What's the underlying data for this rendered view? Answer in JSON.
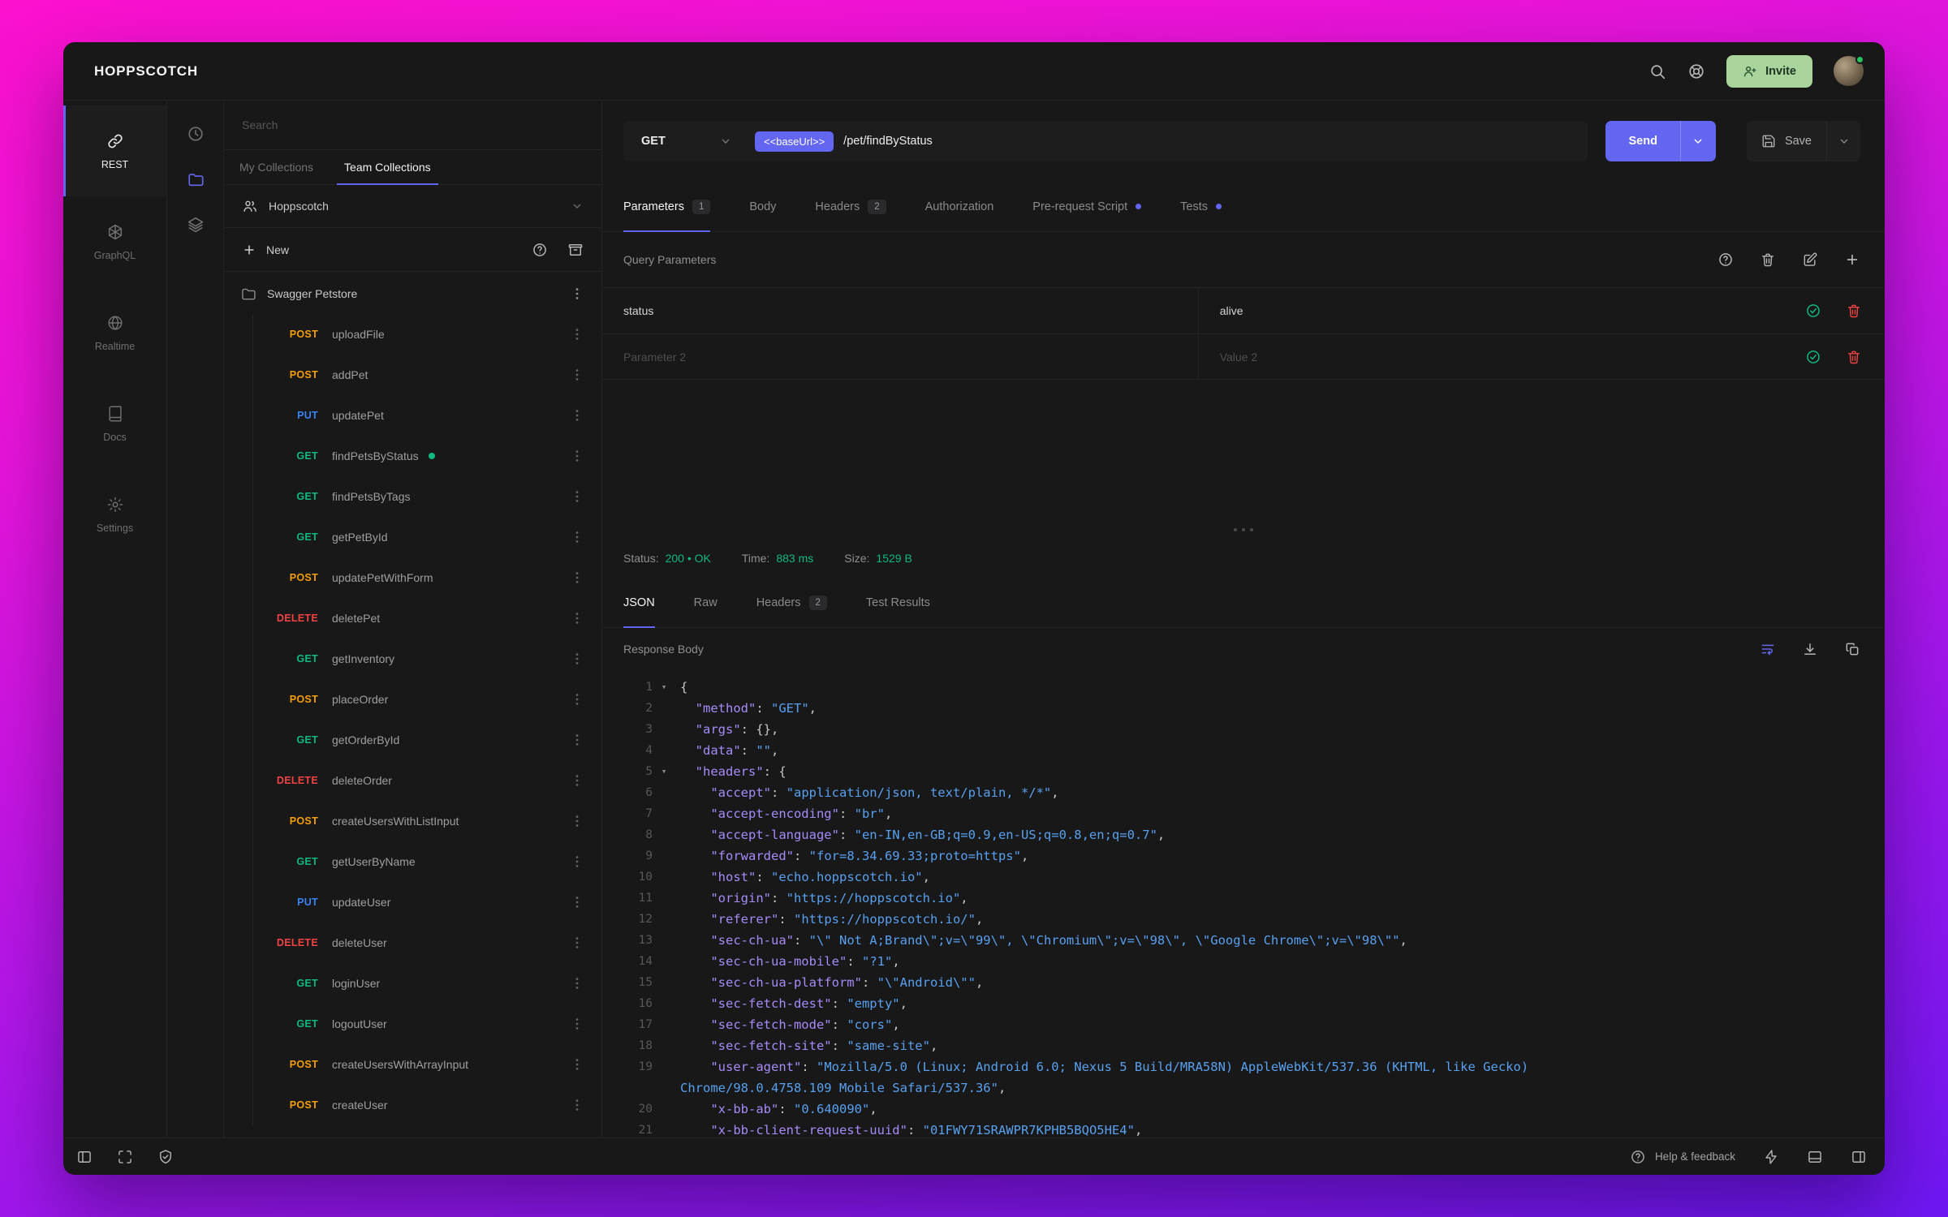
{
  "topbar": {
    "logo": "HOPPSCOTCH",
    "invite_label": "Invite"
  },
  "nav": {
    "items": [
      {
        "label": "REST",
        "state": "active"
      },
      {
        "label": "GraphQL",
        "state": ""
      },
      {
        "label": "Realtime",
        "state": ""
      },
      {
        "label": "Docs",
        "state": ""
      },
      {
        "label": "Settings",
        "state": ""
      }
    ]
  },
  "collections": {
    "search_placeholder": "Search",
    "tabs": [
      {
        "label": "My Collections"
      },
      {
        "label": "Team Collections",
        "state": "active"
      }
    ],
    "team_name": "Hoppscotch",
    "new_label": "New",
    "folder_name": "Swagger Petstore",
    "requests": [
      {
        "method": "POST",
        "name": "uploadFile"
      },
      {
        "method": "POST",
        "name": "addPet"
      },
      {
        "method": "PUT",
        "name": "updatePet"
      },
      {
        "method": "GET",
        "name": "findPetsByStatus",
        "indicator": "on"
      },
      {
        "method": "GET",
        "name": "findPetsByTags"
      },
      {
        "method": "GET",
        "name": "getPetById"
      },
      {
        "method": "POST",
        "name": "updatePetWithForm"
      },
      {
        "method": "DELETE",
        "name": "deletePet"
      },
      {
        "method": "GET",
        "name": "getInventory"
      },
      {
        "method": "POST",
        "name": "placeOrder"
      },
      {
        "method": "GET",
        "name": "getOrderById"
      },
      {
        "method": "DELETE",
        "name": "deleteOrder"
      },
      {
        "method": "POST",
        "name": "createUsersWithListInput"
      },
      {
        "method": "GET",
        "name": "getUserByName"
      },
      {
        "method": "PUT",
        "name": "updateUser"
      },
      {
        "method": "DELETE",
        "name": "deleteUser"
      },
      {
        "method": "GET",
        "name": "loginUser"
      },
      {
        "method": "GET",
        "name": "logoutUser"
      },
      {
        "method": "POST",
        "name": "createUsersWithArrayInput"
      },
      {
        "method": "POST",
        "name": "createUser"
      }
    ]
  },
  "request": {
    "method": "GET",
    "base_url_chip": "<<baseUrl>>",
    "path": "/pet/findByStatus",
    "send_label": "Send",
    "save_label": "Save",
    "tabs": [
      {
        "label": "Parameters",
        "badge": "1",
        "state": "active"
      },
      {
        "label": "Body"
      },
      {
        "label": "Headers",
        "badge": "2"
      },
      {
        "label": "Authorization"
      },
      {
        "label": "Pre-request Script",
        "dot": "on"
      },
      {
        "label": "Tests",
        "dot": "on"
      }
    ],
    "section_title": "Query Parameters",
    "params": [
      {
        "key": "status",
        "value": "alive",
        "state": "filled"
      },
      {
        "key": "Parameter 2",
        "value": "Value 2",
        "state": "ph"
      }
    ]
  },
  "response": {
    "status_label": "Status:",
    "status_value": "200 • OK",
    "time_label": "Time:",
    "time_value": "883 ms",
    "size_label": "Size:",
    "size_value": "1529 B",
    "tabs": [
      {
        "label": "JSON",
        "state": "active"
      },
      {
        "label": "Raw"
      },
      {
        "label": "Headers",
        "badge": "2"
      },
      {
        "label": "Test Results"
      }
    ],
    "body_label": "Response Body",
    "code_lines": [
      {
        "n": "1",
        "fold": "▾",
        "text": "{"
      },
      {
        "n": "2",
        "text": "  \"method\": \"GET\","
      },
      {
        "n": "3",
        "text": "  \"args\": {},"
      },
      {
        "n": "4",
        "text": "  \"data\": \"\","
      },
      {
        "n": "5",
        "fold": "▾",
        "text": "  \"headers\": {"
      },
      {
        "n": "6",
        "text": "    \"accept\": \"application/json, text/plain, */*\","
      },
      {
        "n": "7",
        "text": "    \"accept-encoding\": \"br\","
      },
      {
        "n": "8",
        "text": "    \"accept-language\": \"en-IN,en-GB;q=0.9,en-US;q=0.8,en;q=0.7\","
      },
      {
        "n": "9",
        "text": "    \"forwarded\": \"for=8.34.69.33;proto=https\","
      },
      {
        "n": "10",
        "text": "    \"host\": \"echo.hoppscotch.io\","
      },
      {
        "n": "11",
        "text": "    \"origin\": \"https://hoppscotch.io\","
      },
      {
        "n": "12",
        "text": "    \"referer\": \"https://hoppscotch.io/\","
      },
      {
        "n": "13",
        "text": "    \"sec-ch-ua\": \"\\\" Not A;Brand\\\";v=\\\"99\\\", \\\"Chromium\\\";v=\\\"98\\\", \\\"Google Chrome\\\";v=\\\"98\\\"\","
      },
      {
        "n": "14",
        "text": "    \"sec-ch-ua-mobile\": \"?1\","
      },
      {
        "n": "15",
        "text": "    \"sec-ch-ua-platform\": \"\\\"Android\\\"\","
      },
      {
        "n": "16",
        "text": "    \"sec-fetch-dest\": \"empty\","
      },
      {
        "n": "17",
        "text": "    \"sec-fetch-mode\": \"cors\","
      },
      {
        "n": "18",
        "text": "    \"sec-fetch-site\": \"same-site\","
      },
      {
        "n": "19",
        "text": "    \"user-agent\": \"Mozilla/5.0 (Linux; Android 6.0; Nexus 5 Build/MRA58N) AppleWebKit/537.36 (KHTML, like Gecko) Chrome/98.0.4758.109 Mobile Safari/537.36\","
      },
      {
        "n": "20",
        "text": "    \"x-bb-ab\": \"0.640090\","
      },
      {
        "n": "21",
        "text": "    \"x-bb-client-request-uuid\": \"01FWY71SRAWPR7KPHB5BQO5HE4\","
      }
    ]
  },
  "footer": {
    "help_label": "Help & feedback"
  },
  "colors": {
    "accent": "#6366f1",
    "method_get": "#10b981",
    "method_post": "#f59e0b",
    "method_put": "#3b82f6",
    "method_delete": "#ef4444",
    "status_ok": "#10b981",
    "json_key": "#a78bfa",
    "json_string": "#58a0f0"
  }
}
